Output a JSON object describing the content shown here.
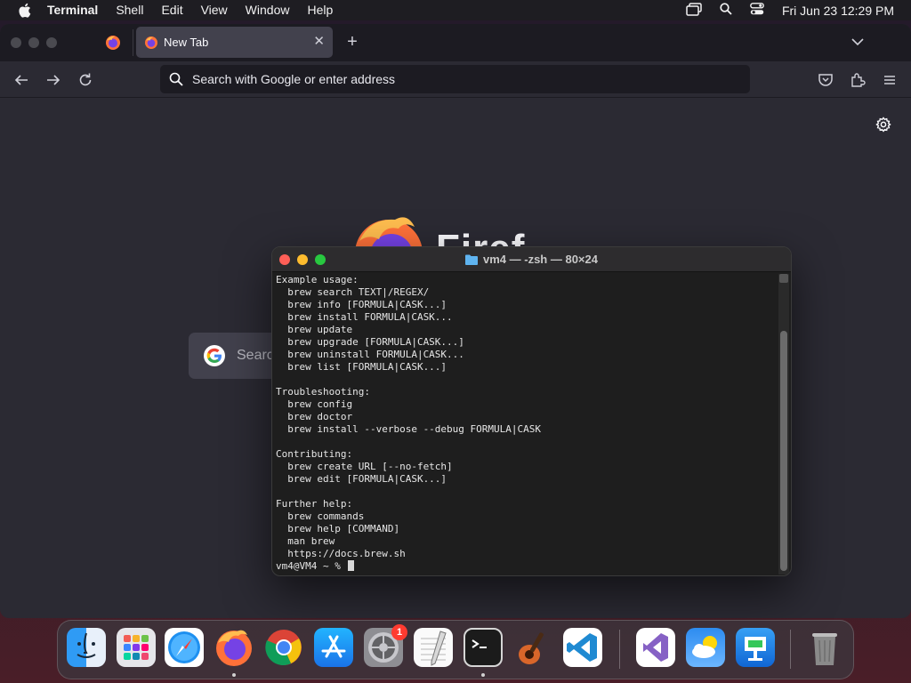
{
  "menubar": {
    "app_name": "Terminal",
    "items": [
      "Shell",
      "Edit",
      "View",
      "Window",
      "Help"
    ],
    "clock": "Fri Jun 23  12:29 PM"
  },
  "browser": {
    "active_tab_title": "New Tab",
    "url_placeholder": "Search with Google or enter address",
    "google_search_placeholder": "Searc"
  },
  "terminal": {
    "title": "vm4 — -zsh — 80×24",
    "lines": [
      "Example usage:",
      "  brew search TEXT|/REGEX/",
      "  brew info [FORMULA|CASK...]",
      "  brew install FORMULA|CASK...",
      "  brew update",
      "  brew upgrade [FORMULA|CASK...]",
      "  brew uninstall FORMULA|CASK...",
      "  brew list [FORMULA|CASK...]",
      "",
      "Troubleshooting:",
      "  brew config",
      "  brew doctor",
      "  brew install --verbose --debug FORMULA|CASK",
      "",
      "Contributing:",
      "  brew create URL [--no-fetch]",
      "  brew edit [FORMULA|CASK...]",
      "",
      "Further help:",
      "  brew commands",
      "  brew help [COMMAND]",
      "  man brew",
      "  https://docs.brew.sh"
    ],
    "prompt": "vm4@VM4 ~ % "
  },
  "dock": {
    "apps": [
      "finder-icon",
      "launchpad-icon",
      "safari-icon",
      "firefox-icon",
      "chrome-icon",
      "app-store-icon",
      "system-settings-icon",
      "textedit-icon",
      "terminal-icon",
      "garageband-icon",
      "vscode-icon",
      "visual-studio-icon",
      "weather-icon",
      "keynote-icon",
      "trash-icon"
    ],
    "settings_badge": "1"
  }
}
